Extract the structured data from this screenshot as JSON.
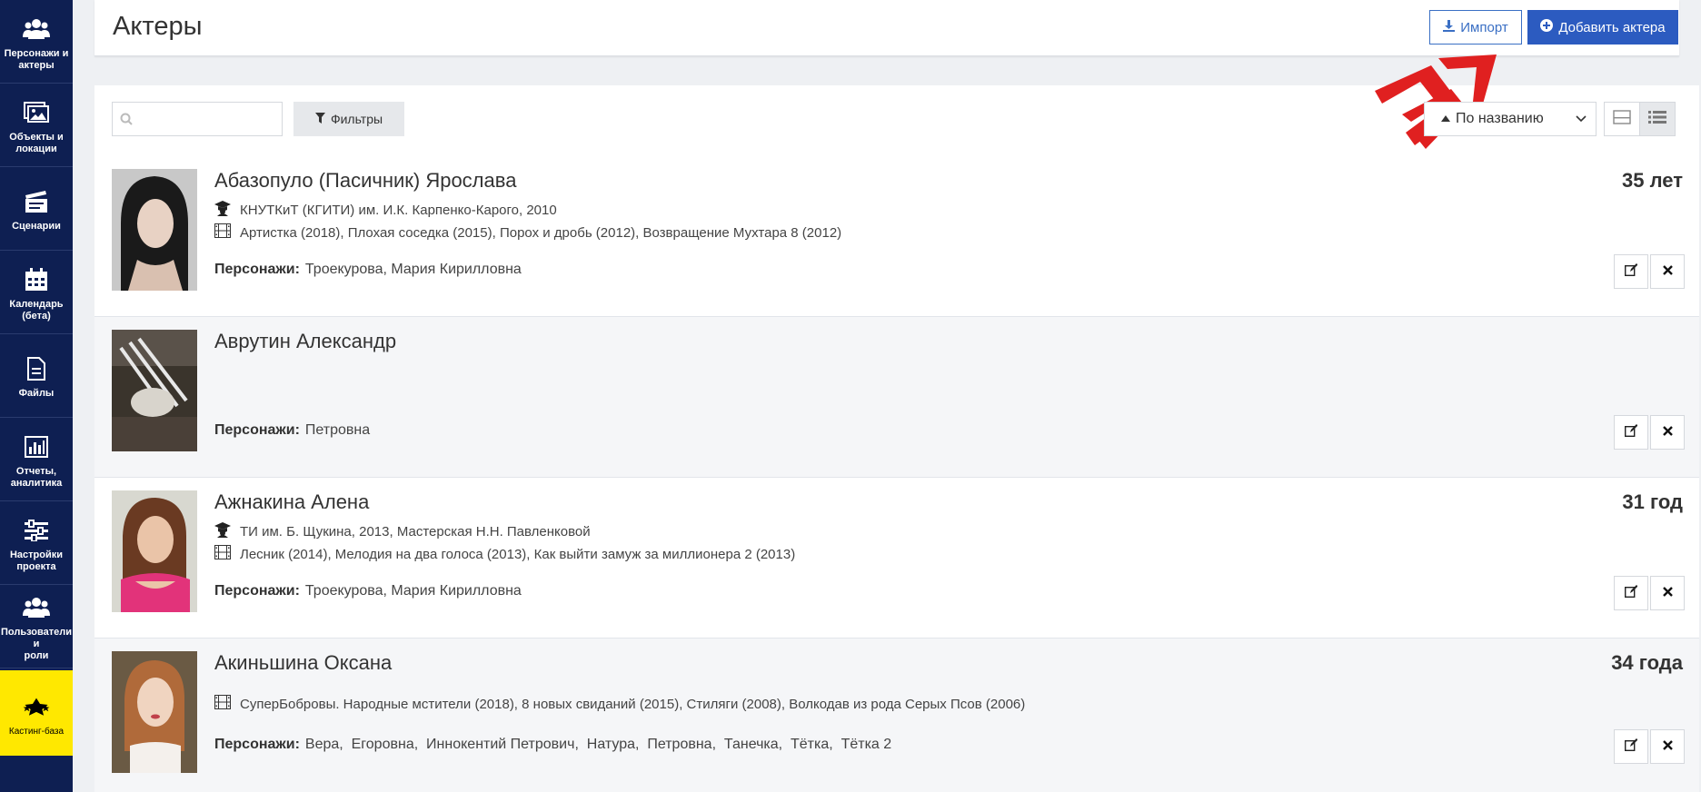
{
  "sidebar": {
    "items": [
      {
        "label": "Персонажи и\nактеры",
        "icon": "users-icon"
      },
      {
        "label": "Объекты и\nлокации",
        "icon": "images-icon"
      },
      {
        "label": "Сценарии",
        "icon": "clapperboard-icon"
      },
      {
        "label": "Календарь\n(бета)",
        "icon": "calendar-icon"
      },
      {
        "label": "Файлы",
        "icon": "file-icon"
      },
      {
        "label": "Отчеты,\nаналитика",
        "icon": "bar-chart-icon"
      },
      {
        "label": "Настройки\nпроекта",
        "icon": "sliders-icon"
      },
      {
        "label": "Пользователи и\nроли",
        "icon": "users-icon"
      },
      {
        "label": "Кастинг-база",
        "icon": "star-icon"
      }
    ]
  },
  "header": {
    "title": "Актеры",
    "import_label": "Импорт",
    "add_label": "Добавить актера"
  },
  "toolbar": {
    "search_value": "",
    "filter_label": "Фильтры",
    "sort_label": "По названию"
  },
  "actors": [
    {
      "name": "Абазопуло (Пасичник) Ярослава",
      "age": "35 лет",
      "education": "КНУТКиТ (КГИТИ) им. И.К. Карпенко-Карого, 2010",
      "films": "Артистка (2018), Плохая соседка (2015), Порох и дробь (2012), Возвращение Мухтара 8 (2012)",
      "characters_label": "Персонажи:",
      "characters": "Троекурова, Мария Кирилловна"
    },
    {
      "name": "Аврутин Александр",
      "age": "",
      "education": "",
      "films": "",
      "characters_label": "Персонажи:",
      "characters": "Петровна"
    },
    {
      "name": "Ажнакина Алена",
      "age": "31 год",
      "education": "ТИ им. Б. Щукина, 2013, Мастерская Н.Н. Павленковой",
      "films": "Лесник (2014), Мелодия на два голоса (2013), Как выйти замуж за миллионера 2 (2013)",
      "characters_label": "Персонажи:",
      "characters": "Троекурова, Мария Кирилловна"
    },
    {
      "name": "Акиньшина Оксана",
      "age": "34 года",
      "education": "",
      "films": "СуперБобровы. Народные мстители (2018), 8 новых свиданий (2015), Стиляги (2008), Волкодав из рода Серых Псов (2006)",
      "characters_label": "Персонажи:",
      "characters": "Вера,  Егоровна,  Иннокентий Петрович,  Натура,  Петровна,  Танечка,  Тётка,  Тётка 2"
    }
  ],
  "colors": {
    "sidebar_bg": "#0e1f52",
    "active_bg": "#ffe800",
    "primary": "#2c5bc0",
    "arrow": "#e02020"
  }
}
